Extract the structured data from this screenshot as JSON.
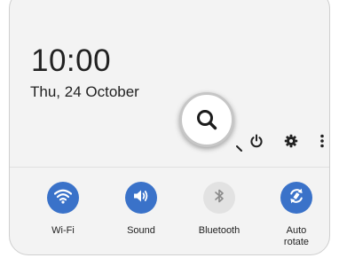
{
  "status": {
    "time": "10:00",
    "date": "Thu, 24 October"
  },
  "header_icons": [
    {
      "name": "search-icon"
    },
    {
      "name": "power-icon"
    },
    {
      "name": "gear-icon"
    },
    {
      "name": "more-vertical-icon"
    }
  ],
  "tiles": [
    {
      "label": "Wi-Fi",
      "icon": "wifi-icon",
      "state": "on"
    },
    {
      "label": "Sound",
      "icon": "sound-icon",
      "state": "on"
    },
    {
      "label": "Bluetooth",
      "icon": "bluetooth-icon",
      "state": "off"
    },
    {
      "label": "Auto rotate",
      "icon": "auto-rotate-icon",
      "state": "on"
    }
  ],
  "colors": {
    "panel_bg": "#f3f3f3",
    "tile_on": "#3a72c9",
    "tile_off": "#e2e2e2",
    "text": "#222222"
  }
}
